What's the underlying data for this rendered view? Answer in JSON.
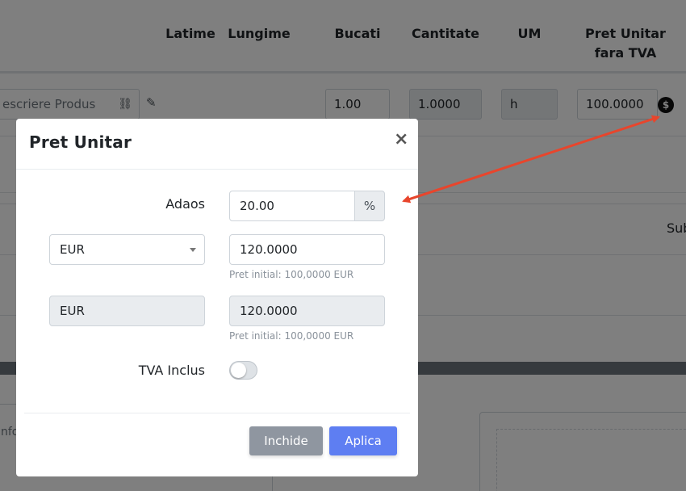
{
  "table_header": {
    "latime": "Latime",
    "lungime": "Lungime",
    "bucati": "Bucati",
    "cantitate": "Cantitate",
    "um": "UM",
    "pret_line1": "Pret Unitar",
    "pret_line2": "fara TVA"
  },
  "row": {
    "product_placeholder": "escriere Produs",
    "bucati": "1.00",
    "cantitate": "1.0000",
    "um": "h",
    "pret": "100.0000",
    "dollar_icon": "$"
  },
  "background": {
    "subtotal_partial": "Sub",
    "info_partial": "nfo"
  },
  "modal": {
    "title": "Pret Unitar",
    "close": "×",
    "adaos_label": "Adaos",
    "adaos_value": "20.00",
    "adaos_addon": "%",
    "currency_select": "EUR",
    "price_value": "120.0000",
    "price_help": "Pret initial: 100,0000 EUR",
    "currency_base": "EUR",
    "base_price_value": "120.0000",
    "base_price_help": "Pret initial: 100,0000 EUR",
    "tva_label": "TVA Inclus",
    "tva_included": false,
    "btn_close": "Inchide",
    "btn_apply": "Aplica"
  },
  "colors": {
    "annotation_arrow": "#e8452c",
    "primary_button": "#5e7ef2",
    "secondary_button": "#8f96a0"
  }
}
